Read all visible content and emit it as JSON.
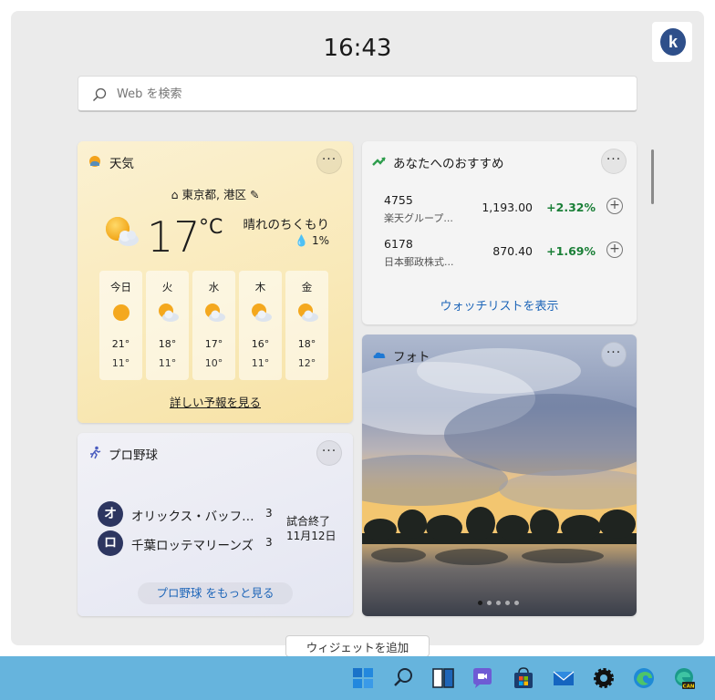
{
  "clock": {
    "time": "16:43"
  },
  "search": {
    "placeholder": "Web を検索"
  },
  "weather": {
    "title": "天気",
    "location": "東京都, 港区",
    "temperature": "17",
    "unit": "°C",
    "condition": "晴れのちくもり",
    "precipitation": "1%",
    "forecast": [
      {
        "day": "今日",
        "icon": "sunny-icon",
        "high": "21°",
        "low": "11°"
      },
      {
        "day": "火",
        "icon": "partly-cloudy-icon",
        "high": "18°",
        "low": "11°"
      },
      {
        "day": "水",
        "icon": "partly-cloudy-icon",
        "high": "17°",
        "low": "10°"
      },
      {
        "day": "木",
        "icon": "partly-cloudy-icon",
        "high": "16°",
        "low": "11°"
      },
      {
        "day": "金",
        "icon": "partly-cloudy-icon",
        "high": "18°",
        "low": "12°"
      }
    ],
    "link": "詳しい予報を見る"
  },
  "recommendations": {
    "title": "あなたへのおすすめ",
    "stocks": [
      {
        "symbol": "4755",
        "name": "楽天グループ...",
        "price": "1,193.00",
        "change": "+2.32%"
      },
      {
        "symbol": "6178",
        "name": "日本郵政株式...",
        "price": "870.40",
        "change": "+1.69%"
      }
    ],
    "link": "ウォッチリストを表示"
  },
  "baseball": {
    "title": "プロ野球",
    "teams": [
      {
        "badge": "オ",
        "name": "オリックス・バッファローズ",
        "score": "3"
      },
      {
        "badge": "ロ",
        "name": "千葉ロッテマリーンズ",
        "score": "3"
      }
    ],
    "status": "試合終了",
    "date": "11月12日",
    "link": "プロ野球 をもっと見る"
  },
  "photos": {
    "title": "フォト"
  },
  "add_widget": {
    "label": "ウィジェットを追加"
  },
  "taskbar": {
    "icons": [
      "start-icon",
      "search-icon",
      "task-view-icon",
      "chat-icon",
      "store-icon",
      "mail-icon",
      "settings-icon",
      "edge-icon",
      "edge-canary-icon"
    ]
  },
  "colors": {
    "accent": "#1d65b8",
    "gain": "#1a7f37",
    "taskbar": "#66b4dd"
  }
}
